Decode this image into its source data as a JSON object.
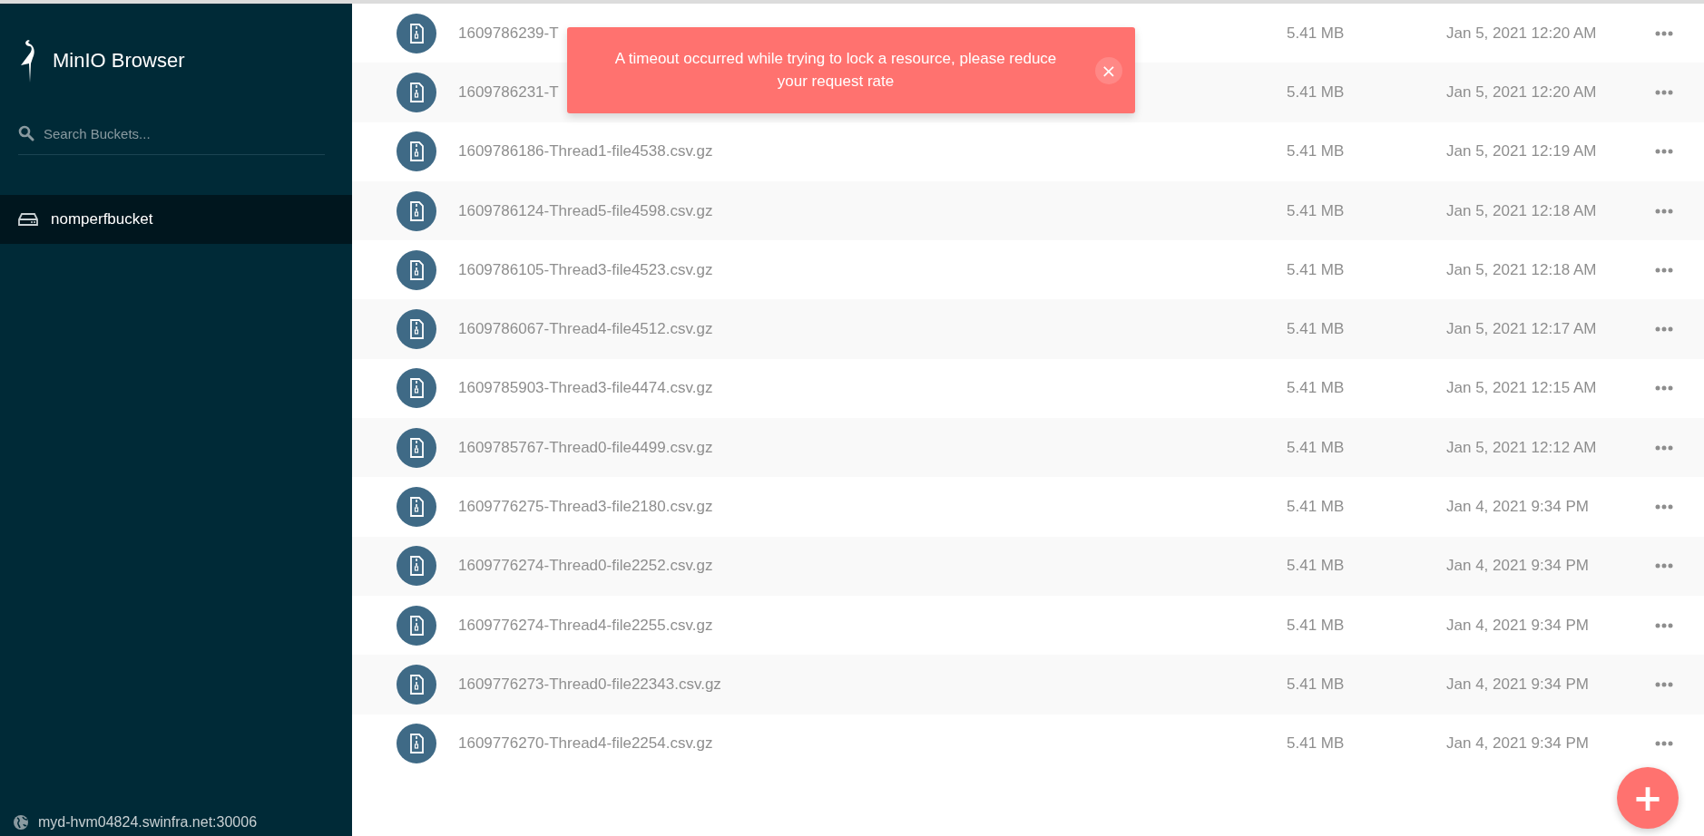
{
  "sidebar": {
    "title": "MinIO Browser",
    "search": {
      "placeholder": "Search Buckets..."
    },
    "buckets": [
      {
        "name": "nomperfbucket",
        "selected": true
      }
    ],
    "host": "myd-hvm04824.swinfra.net:30006"
  },
  "files": [
    {
      "name": "1609786239-T",
      "size": "5.41 MB",
      "modified": "Jan 5, 2021 12:20 AM"
    },
    {
      "name": "1609786231-T",
      "size": "5.41 MB",
      "modified": "Jan 5, 2021 12:20 AM"
    },
    {
      "name": "1609786186-Thread1-file4538.csv.gz",
      "size": "5.41 MB",
      "modified": "Jan 5, 2021 12:19 AM"
    },
    {
      "name": "1609786124-Thread5-file4598.csv.gz",
      "size": "5.41 MB",
      "modified": "Jan 5, 2021 12:18 AM"
    },
    {
      "name": "1609786105-Thread3-file4523.csv.gz",
      "size": "5.41 MB",
      "modified": "Jan 5, 2021 12:18 AM"
    },
    {
      "name": "1609786067-Thread4-file4512.csv.gz",
      "size": "5.41 MB",
      "modified": "Jan 5, 2021 12:17 AM"
    },
    {
      "name": "1609785903-Thread3-file4474.csv.gz",
      "size": "5.41 MB",
      "modified": "Jan 5, 2021 12:15 AM"
    },
    {
      "name": "1609785767-Thread0-file4499.csv.gz",
      "size": "5.41 MB",
      "modified": "Jan 5, 2021 12:12 AM"
    },
    {
      "name": "1609776275-Thread3-file2180.csv.gz",
      "size": "5.41 MB",
      "modified": "Jan 4, 2021 9:34 PM"
    },
    {
      "name": "1609776274-Thread0-file2252.csv.gz",
      "size": "5.41 MB",
      "modified": "Jan 4, 2021 9:34 PM"
    },
    {
      "name": "1609776274-Thread4-file2255.csv.gz",
      "size": "5.41 MB",
      "modified": "Jan 4, 2021 9:34 PM"
    },
    {
      "name": "1609776273-Thread0-file22343.csv.gz",
      "size": "5.41 MB",
      "modified": "Jan 4, 2021 9:34 PM"
    },
    {
      "name": "1609776270-Thread4-file2254.csv.gz",
      "size": "5.41 MB",
      "modified": "Jan 4, 2021 9:34 PM"
    }
  ],
  "toast": {
    "message": "A timeout occurred while trying to lock a resource, please reduce your request rate",
    "close": "×"
  },
  "fab": {
    "label": "+"
  }
}
